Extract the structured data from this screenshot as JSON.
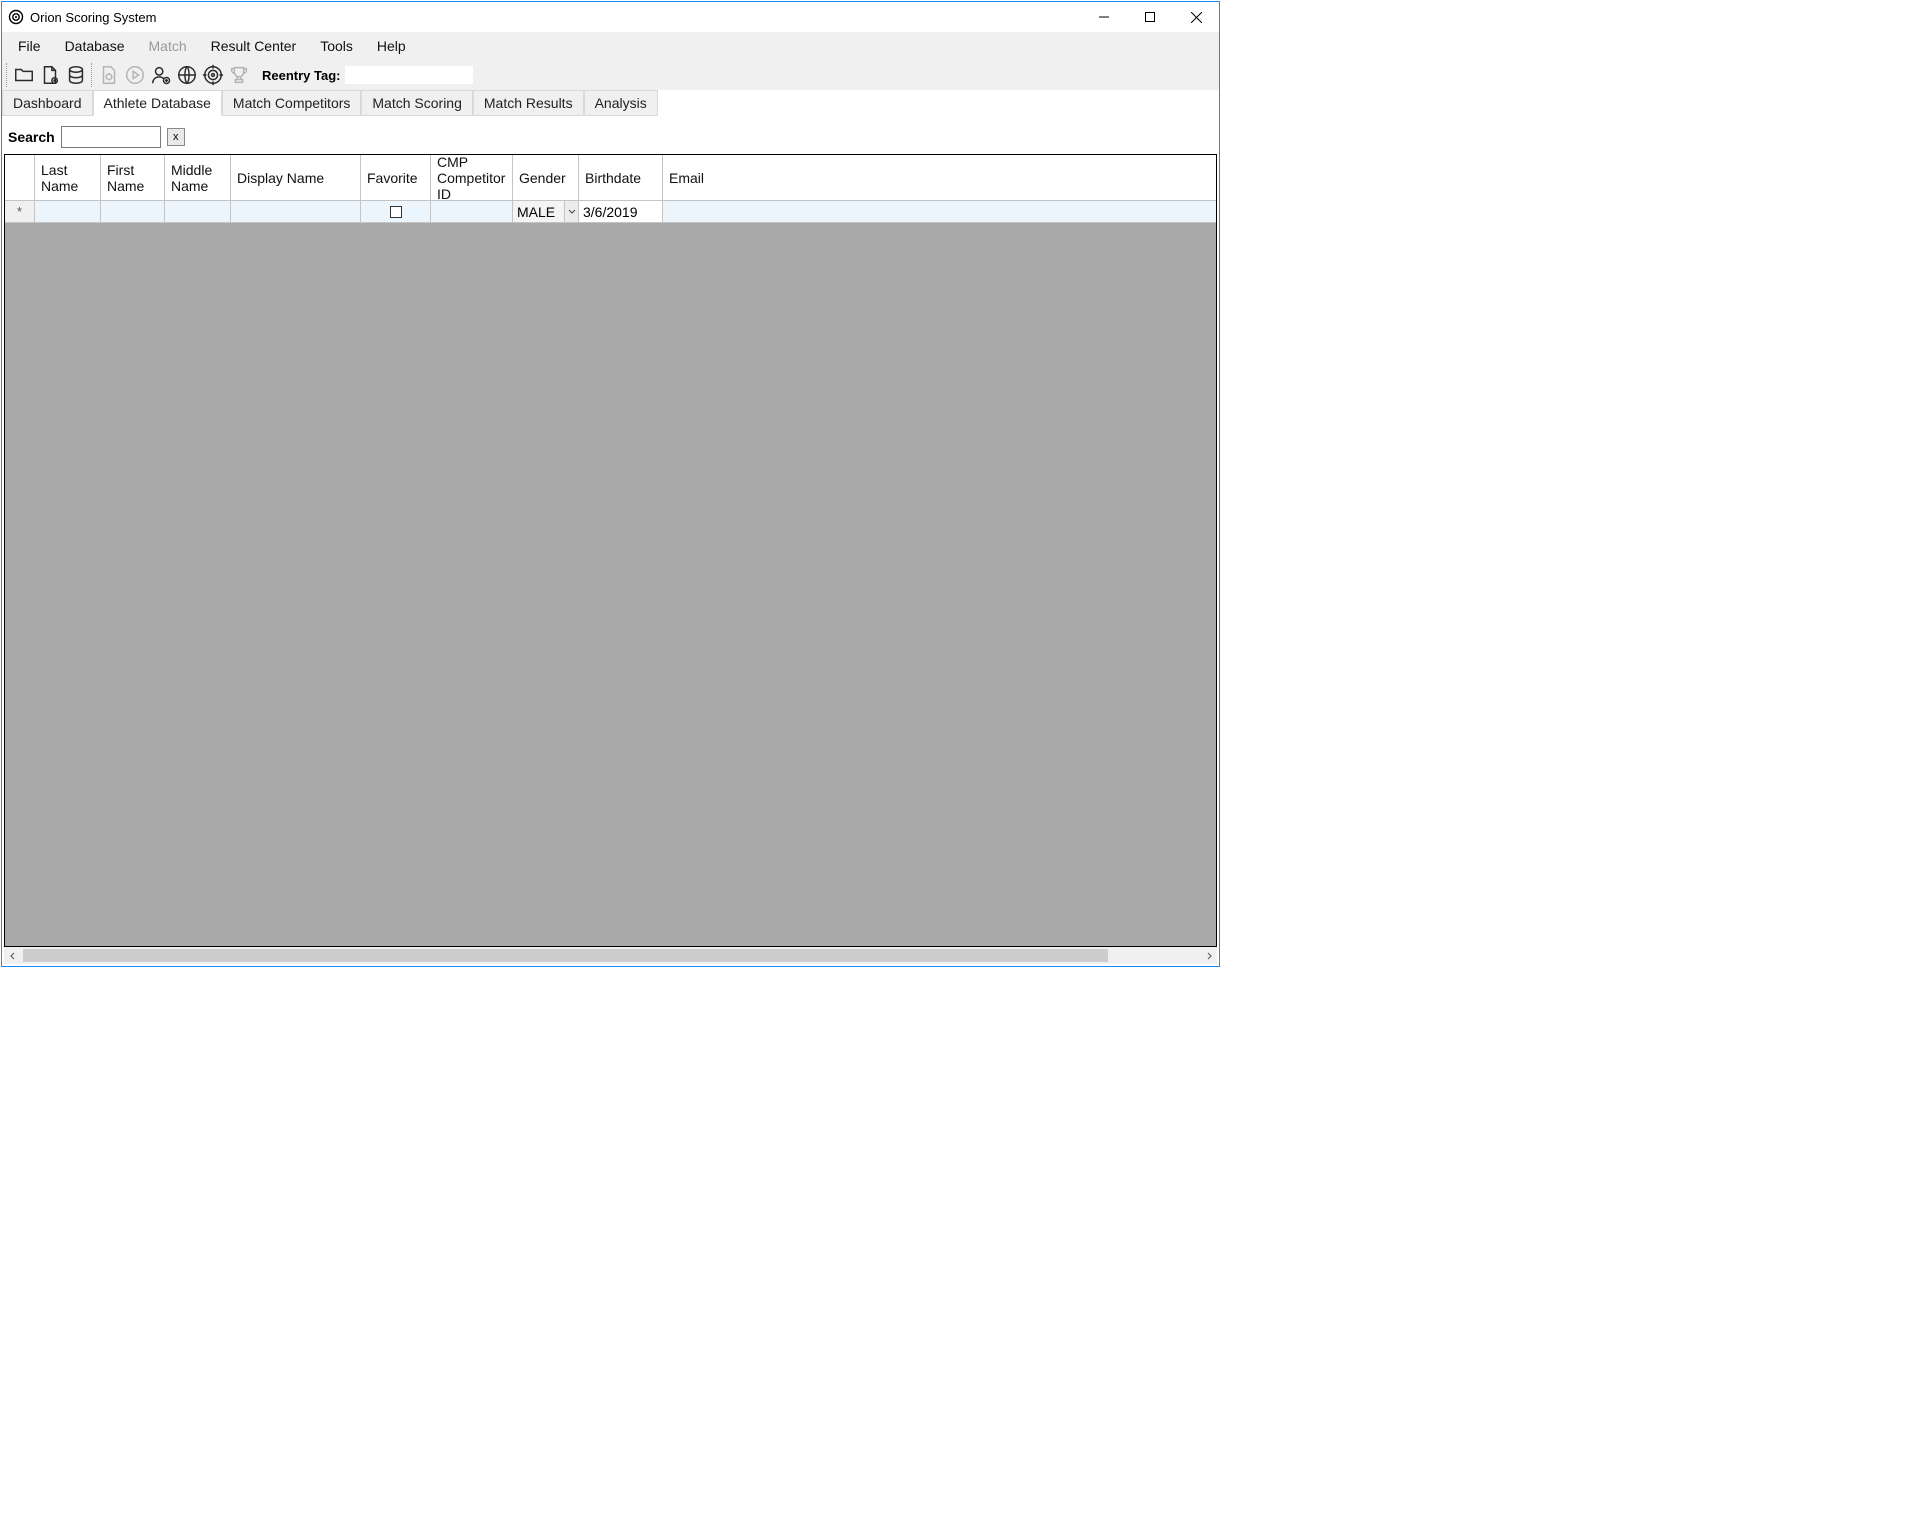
{
  "window": {
    "title": "Orion Scoring System"
  },
  "menu": {
    "file": "File",
    "database": "Database",
    "match": "Match",
    "result_center": "Result Center",
    "tools": "Tools",
    "help": "Help"
  },
  "toolbar": {
    "reentry_label": "Reentry Tag:",
    "reentry_value": ""
  },
  "tabs": {
    "dashboard": "Dashboard",
    "athlete_db": "Athlete Database",
    "match_competitors": "Match Competitors",
    "match_scoring": "Match Scoring",
    "match_results": "Match Results",
    "analysis": "Analysis",
    "active": "athlete_db"
  },
  "search": {
    "label": "Search",
    "value": "",
    "clear": "x"
  },
  "grid": {
    "columns": {
      "row_indicator": "",
      "last_name": "Last Name",
      "first_name": "First Name",
      "middle_name": "Middle Name",
      "display_name": "Display Name",
      "favorite": "Favorite",
      "cmp_id": "CMP Competitor ID",
      "gender": "Gender",
      "birthdate": "Birthdate",
      "email": "Email"
    },
    "new_row": {
      "indicator": "*",
      "last_name": "",
      "first_name": "",
      "middle_name": "",
      "display_name": "",
      "favorite_checked": false,
      "cmp_id": "",
      "gender": "MALE",
      "birthdate": "3/6/2019",
      "email": ""
    }
  }
}
